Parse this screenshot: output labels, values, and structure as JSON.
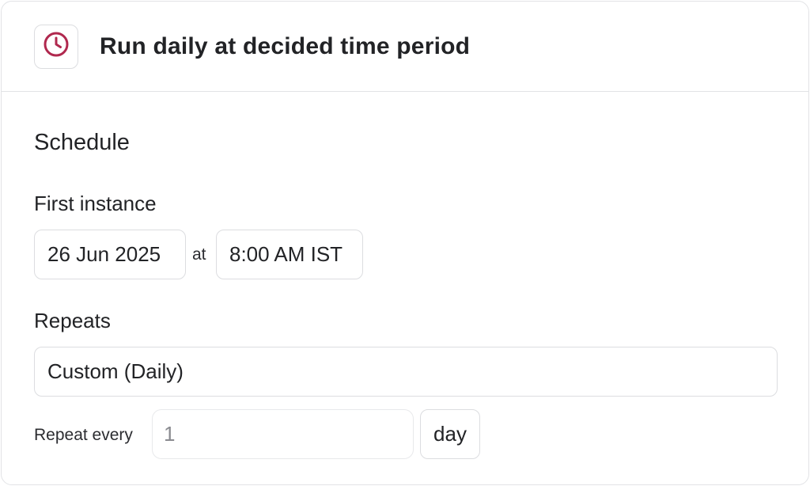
{
  "header": {
    "icon": "clock-icon",
    "icon_color": "#b0284e",
    "title": "Run daily at decided time period"
  },
  "schedule": {
    "section_title": "Schedule",
    "first_instance": {
      "label": "First instance",
      "date": "26 Jun 2025",
      "at_label": "at",
      "time": "8:00 AM IST"
    },
    "repeats": {
      "label": "Repeats",
      "value": "Custom (Daily)"
    },
    "repeat_every": {
      "label": "Repeat every",
      "value": "1",
      "unit": "day"
    }
  }
}
